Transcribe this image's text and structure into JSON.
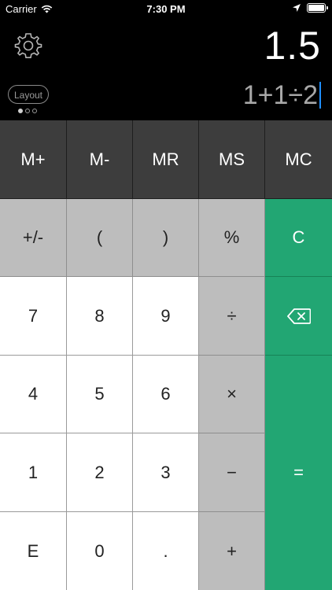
{
  "status_bar": {
    "carrier": "Carrier",
    "time": "7:30 PM",
    "icons": [
      "wifi-icon",
      "location-arrow-icon",
      "battery-icon"
    ]
  },
  "display": {
    "result": "1.5",
    "expression": "1+1÷2"
  },
  "header": {
    "settings_icon": "gear-icon",
    "layout_label": "Layout",
    "page_indicator": {
      "count": 3,
      "active": 0
    }
  },
  "keys": {
    "memory": [
      "M+",
      "M-",
      "MR",
      "MS",
      "MC"
    ],
    "row2": [
      "+/-",
      "(",
      ")",
      "%"
    ],
    "clear": "C",
    "row3": [
      "7",
      "8",
      "9",
      "÷"
    ],
    "backspace_icon": "backspace-icon",
    "row4": [
      "4",
      "5",
      "6",
      "×"
    ],
    "row5": [
      "1",
      "2",
      "3",
      "−"
    ],
    "row6": [
      "E",
      "0",
      ".",
      "+"
    ],
    "equals": "="
  },
  "colors": {
    "background": "#000000",
    "memory_key": "#3d3d3d",
    "operator_key": "#bdbdbd",
    "number_key": "#ffffff",
    "accent_green": "#22a673",
    "caret": "#1f8fff"
  }
}
